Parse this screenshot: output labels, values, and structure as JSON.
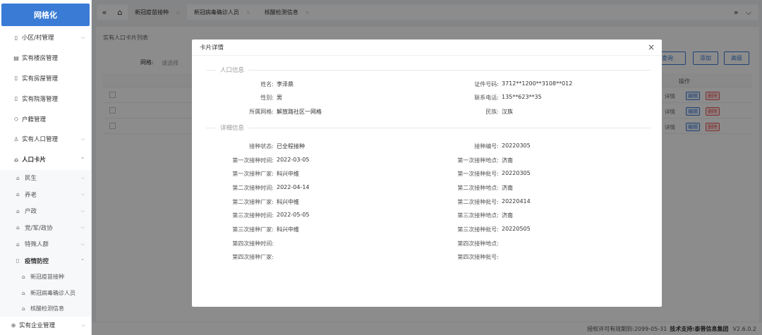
{
  "sidebar": {
    "logo": "网格化",
    "items": [
      {
        "label": "小区/村管理"
      },
      {
        "label": "实有楼房管理"
      },
      {
        "label": "实有房屋管理"
      },
      {
        "label": "实有院落管理"
      },
      {
        "label": "户籍管理"
      },
      {
        "label": "实有人口管理"
      },
      {
        "label": "人口卡片"
      }
    ],
    "sub_items": [
      {
        "label": "民生"
      },
      {
        "label": "养老"
      },
      {
        "label": "户政"
      },
      {
        "label": "党/军/政协"
      },
      {
        "label": "特殊人群"
      },
      {
        "label": "疫情防控"
      }
    ],
    "leaf_items": [
      {
        "label": "新冠疫苗接种"
      },
      {
        "label": "新冠病毒确诊人员"
      },
      {
        "label": "核酸检测信息"
      }
    ],
    "bottom_item": {
      "label": "实有企业管理"
    }
  },
  "tabs": [
    {
      "label": "新冠疫苗接种",
      "active": true
    },
    {
      "label": "新冠病毒确诊人员"
    },
    {
      "label": "核酸检测信息"
    }
  ],
  "main": {
    "title": "实有人口卡片列表",
    "filter_label": "网格:",
    "filter_placeholder": "请选择",
    "btn_query": "查询",
    "btn_add": "添加",
    "btn_advanced": "高级",
    "ops_header": "操作",
    "row_op": "详情",
    "row_edit": "编辑",
    "row_delete": "删除"
  },
  "modal": {
    "title": "卡片详情",
    "section_basic": "人口信息",
    "section_detail": "详细信息",
    "basic": [
      {
        "label": "姓名:",
        "value": "李泽鼎"
      },
      {
        "label": "证件号码:",
        "value": "3712**1200**3108**012"
      },
      {
        "label": "性别:",
        "value": "男"
      },
      {
        "label": "联系电话:",
        "value": "135**623**35"
      },
      {
        "label": "所属网格:",
        "value": "解放路社区一网格"
      },
      {
        "label": "民族:",
        "value": "汉族"
      }
    ],
    "detail": [
      {
        "label": "接种状态:",
        "value": "已全程接种"
      },
      {
        "label": "接种编号:",
        "value": "20220305"
      },
      {
        "label": "第一次接种时间:",
        "value": "2022-03-05"
      },
      {
        "label": "第一次接种地点:",
        "value": "济南"
      },
      {
        "label": "第一次接种厂家:",
        "value": "科兴中维"
      },
      {
        "label": "第一次接种批号:",
        "value": "20220305"
      },
      {
        "label": "第二次接种时间:",
        "value": "2022-04-14"
      },
      {
        "label": "第二次接种地点:",
        "value": "济南"
      },
      {
        "label": "第二次接种厂家:",
        "value": "科兴中维"
      },
      {
        "label": "第二次接种批号:",
        "value": "20220414"
      },
      {
        "label": "第三次接种时间:",
        "value": "2022-05-05"
      },
      {
        "label": "第三次接种地点:",
        "value": "济南"
      },
      {
        "label": "第三次接种厂家:",
        "value": "科兴中维"
      },
      {
        "label": "第三次接种批号:",
        "value": "20220505"
      },
      {
        "label": "第四次接种时间:",
        "value": ""
      },
      {
        "label": "第四次接种地点:",
        "value": ""
      },
      {
        "label": "第四次接种厂家:",
        "value": ""
      },
      {
        "label": "第四次接种批号:",
        "value": ""
      }
    ]
  },
  "footer": {
    "license": "授权许可有效期到:",
    "license_date": "2099-05-31",
    "support_label": "技术支持:",
    "support_company": "泰晋信息集团",
    "version": "V2.6.0.2"
  }
}
